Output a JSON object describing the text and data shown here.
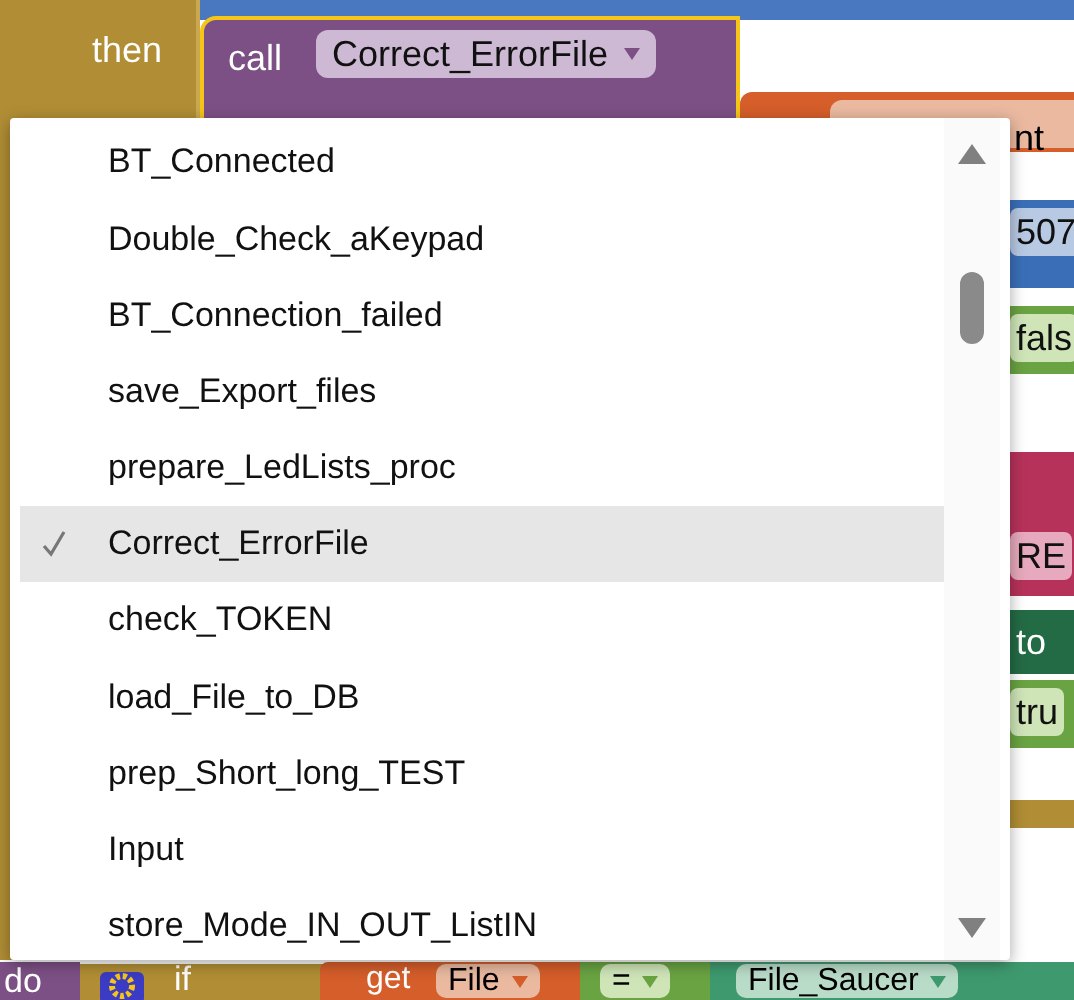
{
  "blocks": {
    "then_label": "then",
    "call_label": "call",
    "procedure": "Correct_ErrorFile",
    "component_field": "nt"
  },
  "menu": {
    "items": [
      {
        "label": "BT_Connected",
        "selected": false
      },
      {
        "label": "Double_Check_aKeypad",
        "selected": false
      },
      {
        "label": "BT_Connection_failed",
        "selected": false
      },
      {
        "label": "save_Export_files",
        "selected": false
      },
      {
        "label": "prepare_LedLists_proc",
        "selected": false
      },
      {
        "label": "Correct_ErrorFile",
        "selected": true
      },
      {
        "label": "check_TOKEN",
        "selected": false
      },
      {
        "label": "load_File_to_DB",
        "selected": false
      },
      {
        "label": "prep_Short_long_TEST",
        "selected": false
      },
      {
        "label": "Input",
        "selected": false
      },
      {
        "label": "store_Mode_IN_OUT_ListIN",
        "selected": false
      }
    ]
  },
  "side_blocks": [
    {
      "kind": "number",
      "text": "507"
    },
    {
      "kind": "logic",
      "text": "fals"
    },
    {
      "kind": "string",
      "text": "RE"
    },
    {
      "kind": "to",
      "text": "to"
    },
    {
      "kind": "logic",
      "text": "tru"
    }
  ],
  "bottom": {
    "do_label": "do",
    "if_label": "if",
    "get_label": "get",
    "variable": "File",
    "operator": "=",
    "value": "File_Saucer"
  }
}
